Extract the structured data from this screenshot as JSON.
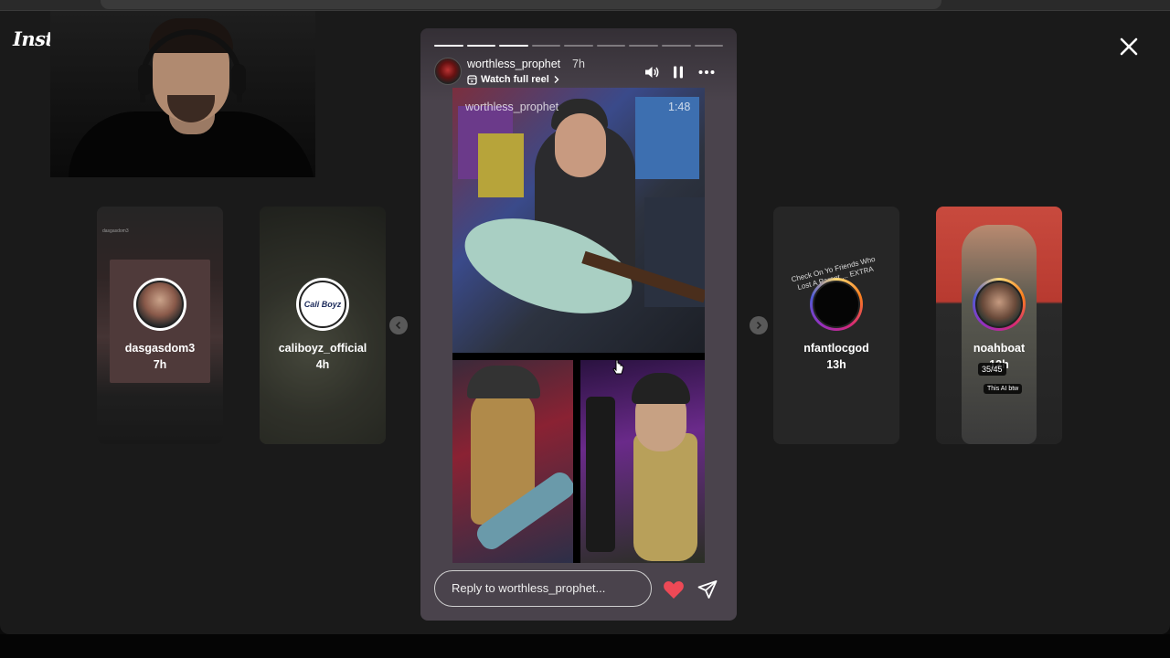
{
  "app": {
    "logo_text": "Instagram"
  },
  "story_viewer": {
    "progress_total": 9,
    "progress_done": 3,
    "owner": {
      "username": "worthless_prophet",
      "age": "7h"
    },
    "watch_full_reel_label": "Watch full reel",
    "media_overlay": {
      "username": "worthless_prophet",
      "duration": "1:48"
    },
    "reply_placeholder": "Reply to worthless_prophet...",
    "icons": {
      "sound": "volume-icon",
      "pause": "pause-icon",
      "more": "more-icon",
      "like": "heart-icon",
      "send": "send-icon"
    },
    "like_color": "#ed4956"
  },
  "prev_stories": [
    {
      "username": "dasgasdom3",
      "age": "7h",
      "ring": "gradient"
    },
    {
      "username": "caliboyz_official",
      "age": "4h",
      "ring": "gradient",
      "avatar_text": "Cali Boyz"
    }
  ],
  "next_stories": [
    {
      "username": "nfantlocgod",
      "age": "13h",
      "ring": "gradient",
      "preview_text": "Check On Yo Friends Who Lost A Parent ... EXTRA"
    },
    {
      "username": "noahboat",
      "age": "12h",
      "ring": "gradient",
      "counter_badge": "35/45",
      "ai_badge": "This AI btw"
    }
  ],
  "nav": {
    "prev_icon": "chevron-left-icon",
    "next_icon": "chevron-right-icon",
    "close_icon": "close-icon"
  }
}
